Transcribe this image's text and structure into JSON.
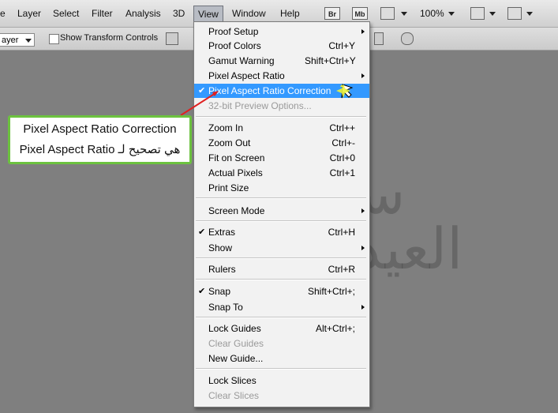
{
  "menubar": {
    "items": [
      "e",
      "Layer",
      "Select",
      "Filter",
      "Analysis",
      "3D",
      "View",
      "Window",
      "Help"
    ],
    "bridge": "Br",
    "minibridge": "Mb",
    "zoom": "100%"
  },
  "options": {
    "layer_select": "ayer",
    "transform_label": "Show Transform Controls"
  },
  "view_menu": {
    "items": [
      {
        "label": "Proof Setup",
        "shortcut": "",
        "submenu": true
      },
      {
        "label": "Proof Colors",
        "shortcut": "Ctrl+Y"
      },
      {
        "label": "Gamut Warning",
        "shortcut": "Shift+Ctrl+Y"
      },
      {
        "label": "Pixel Aspect Ratio",
        "shortcut": "",
        "submenu": true
      },
      {
        "label": "Pixel Aspect Ratio Correction",
        "shortcut": "",
        "checked": true,
        "highlight": true
      },
      {
        "label": "32-bit Preview Options...",
        "shortcut": "",
        "disabled": true
      },
      {
        "label": "Zoom In",
        "shortcut": "Ctrl++"
      },
      {
        "label": "Zoom Out",
        "shortcut": "Ctrl+-"
      },
      {
        "label": "Fit on Screen",
        "shortcut": "Ctrl+0"
      },
      {
        "label": "Actual Pixels",
        "shortcut": "Ctrl+1"
      },
      {
        "label": "Print Size",
        "shortcut": ""
      },
      {
        "label": "Screen Mode",
        "shortcut": "",
        "submenu": true
      },
      {
        "label": "Extras",
        "shortcut": "Ctrl+H",
        "checked": true
      },
      {
        "label": "Show",
        "shortcut": "",
        "submenu": true
      },
      {
        "label": "Rulers",
        "shortcut": "Ctrl+R"
      },
      {
        "label": "Snap",
        "shortcut": "Shift+Ctrl+;",
        "checked": true
      },
      {
        "label": "Snap To",
        "shortcut": "",
        "submenu": true
      },
      {
        "label": "Lock Guides",
        "shortcut": "Alt+Ctrl+;"
      },
      {
        "label": "Clear Guides",
        "shortcut": "",
        "disabled": true
      },
      {
        "label": "New Guide...",
        "shortcut": ""
      },
      {
        "label": "Lock Slices",
        "shortcut": ""
      },
      {
        "label": "Clear Slices",
        "shortcut": "",
        "disabled": true
      }
    ]
  },
  "callout": {
    "line1": "Pixel Aspect Ratio Correction",
    "line2": "هي تصحيح لـ Pixel Aspect Ratio"
  },
  "watermark": {
    "line1": "سمير",
    "line2": "العيداني"
  },
  "colors": {
    "highlight": "#3399ff",
    "callout_border": "#6cc23f",
    "arrow": "#e02020"
  }
}
